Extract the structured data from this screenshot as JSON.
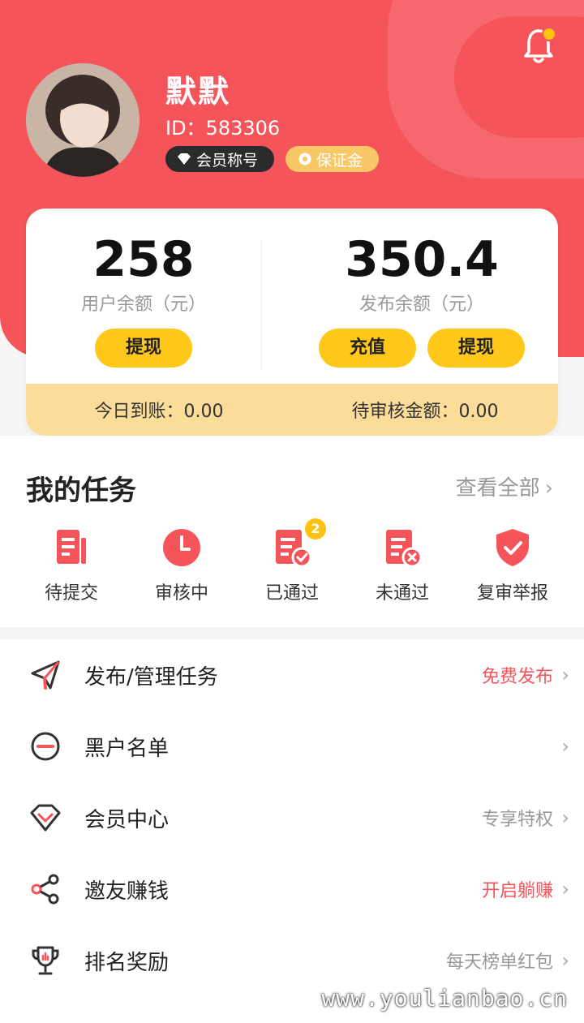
{
  "profile": {
    "name": "默默",
    "id": "ID：583306",
    "member_badge": "会员称号",
    "deposit_badge": "保证金"
  },
  "balance": {
    "user_amount": "258",
    "user_label": "用户余额（元）",
    "user_withdraw": "提现",
    "publish_amount": "350.4",
    "publish_label": "发布余额（元）",
    "publish_recharge": "充值",
    "publish_withdraw": "提现",
    "today_arrival": "今日到账：0.00",
    "pending_review": "待审核金额：0.00"
  },
  "tasks": {
    "title": "我的任务",
    "view_all": "查看全部",
    "items": [
      {
        "label": "待提交",
        "icon": "document-icon"
      },
      {
        "label": "审核中",
        "icon": "clock-icon"
      },
      {
        "label": "已通过",
        "icon": "document-check-icon",
        "badge": "2"
      },
      {
        "label": "未通过",
        "icon": "document-x-icon"
      },
      {
        "label": "复审举报",
        "icon": "shield-check-icon"
      }
    ]
  },
  "menu": [
    {
      "label": "发布/管理任务",
      "right": "免费发布",
      "right_red": true,
      "icon": "send-icon"
    },
    {
      "label": "黑户名单",
      "right": "",
      "right_red": false,
      "icon": "minus-circle-icon"
    },
    {
      "label": "会员中心",
      "right": "专享特权",
      "right_red": false,
      "icon": "diamond-icon"
    },
    {
      "label": "邀友赚钱",
      "right": "开启躺赚",
      "right_red": true,
      "icon": "share-icon"
    },
    {
      "label": "排名奖励",
      "right": "每天榜单红包",
      "right_red": false,
      "icon": "trophy-icon"
    }
  ],
  "watermark": "www.youlianbao.cn",
  "colors": {
    "primary": "#f5545a",
    "accent": "#ffc81a",
    "footer": "#fbdc98"
  }
}
